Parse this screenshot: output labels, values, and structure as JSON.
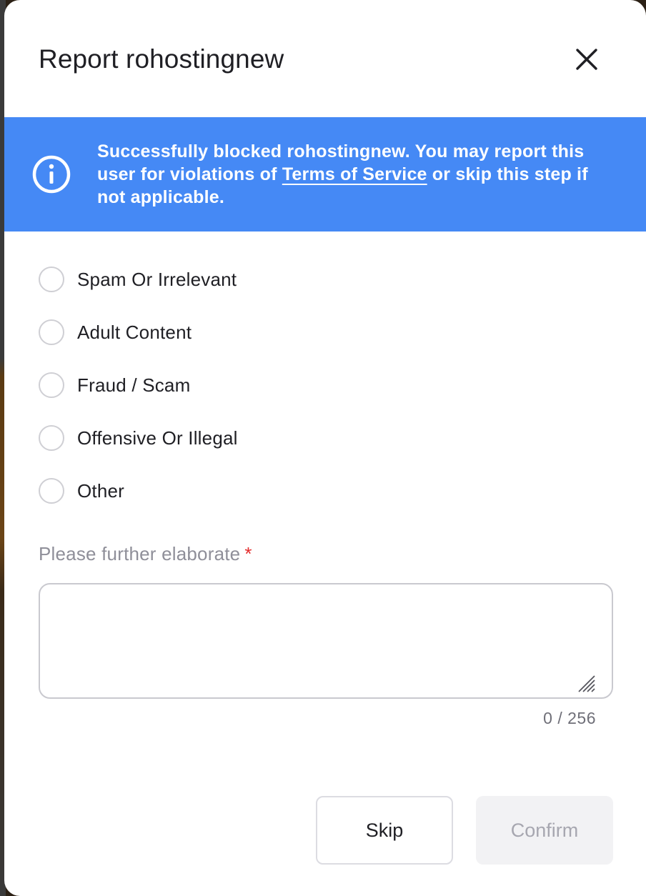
{
  "dialog": {
    "title": "Report rohostingnew",
    "close_icon": "close-icon"
  },
  "banner": {
    "icon": "info-circle-icon",
    "text_before": "Successfully blocked rohostingnew. You may report this user for violations of ",
    "link_text": "Terms of Service",
    "text_after": " or skip this step if not applicable.",
    "color": "#4589f5"
  },
  "report_reasons": [
    {
      "label": "Spam Or Irrelevant",
      "selected": false
    },
    {
      "label": "Adult Content",
      "selected": false
    },
    {
      "label": "Fraud / Scam",
      "selected": false
    },
    {
      "label": "Offensive Or Illegal",
      "selected": false
    },
    {
      "label": "Other",
      "selected": false
    }
  ],
  "elaborate": {
    "label": "Please further elaborate",
    "required_mark": "*",
    "value": "",
    "counter": "0 / 256"
  },
  "actions": {
    "skip_label": "Skip",
    "confirm_label": "Confirm",
    "confirm_disabled": true
  }
}
